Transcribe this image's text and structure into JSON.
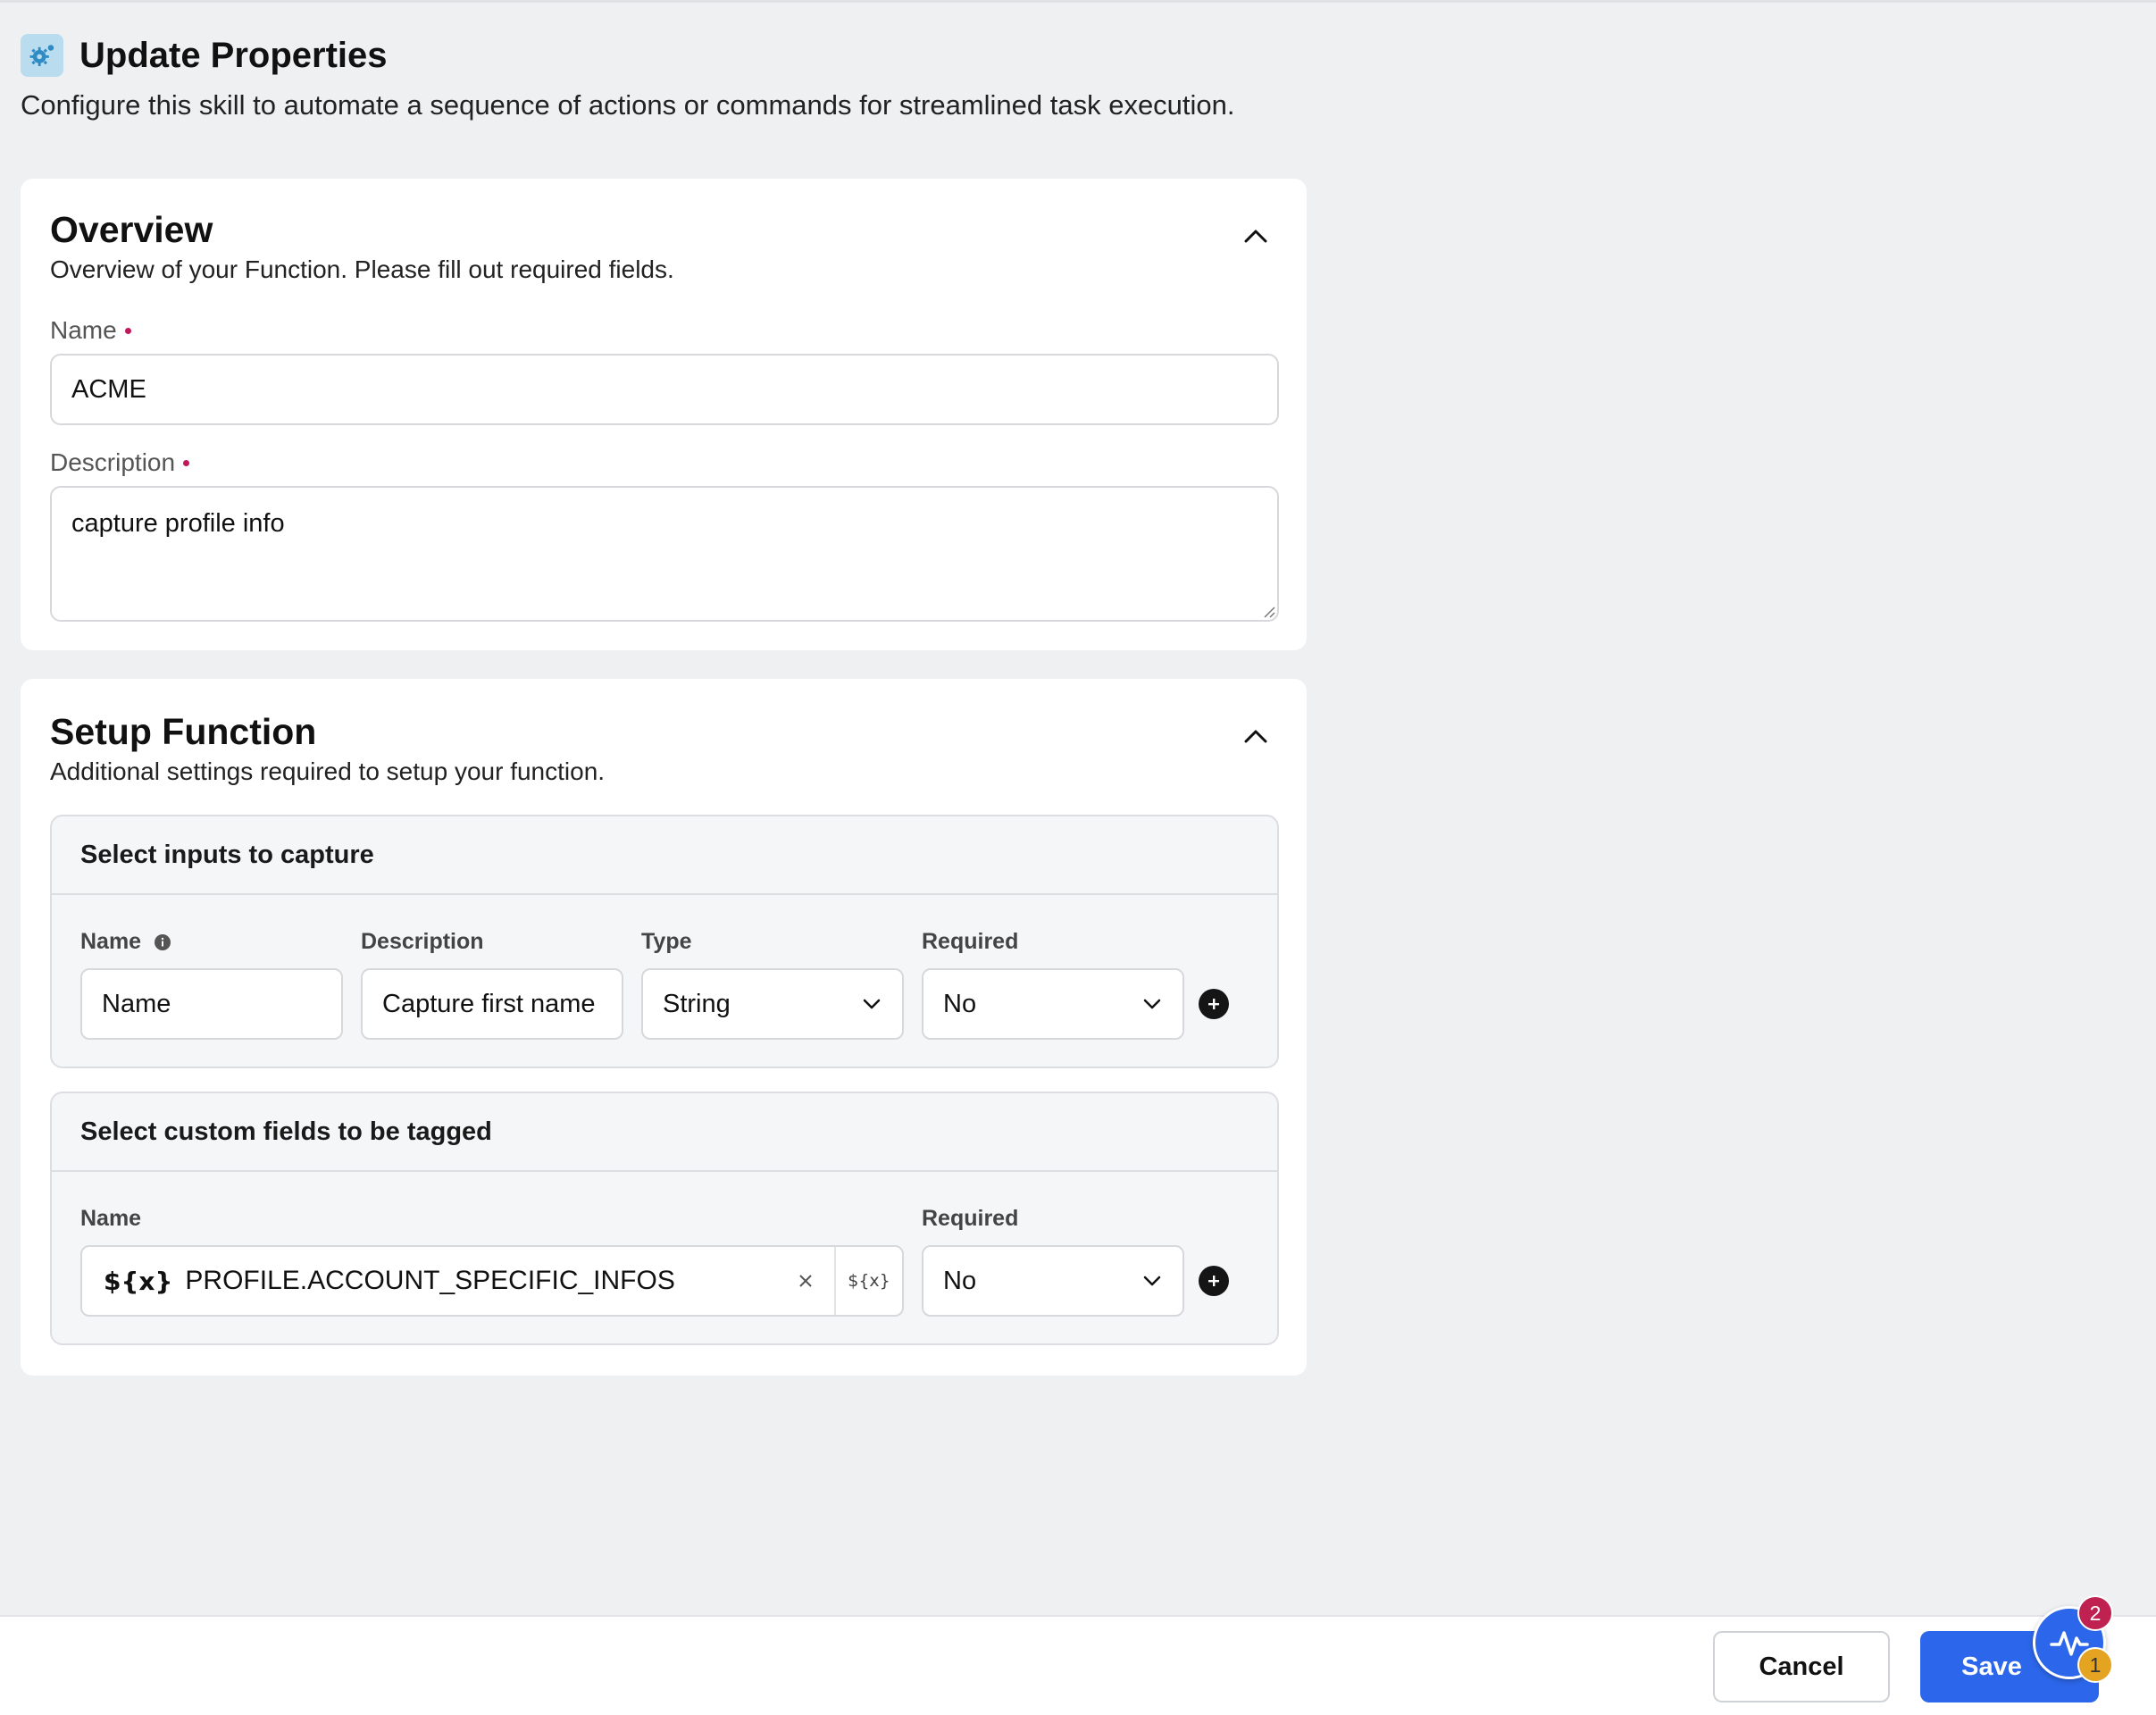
{
  "header": {
    "title": "Update Properties",
    "subtitle": "Configure this skill to automate a sequence of actions or commands for streamlined task execution.",
    "icon": "gear-icon"
  },
  "overview": {
    "title": "Overview",
    "description": "Overview of your Function. Please fill out required fields.",
    "name_label": "Name",
    "name_value": "ACME",
    "description_label": "Description",
    "description_value": "capture profile info"
  },
  "setup": {
    "title": "Setup Function",
    "description": "Additional settings required to setup your function.",
    "inputs_panel": {
      "title": "Select inputs to capture",
      "columns": [
        "Name",
        "Description",
        "Type",
        "Required"
      ],
      "row": {
        "name": "Name",
        "description": "Capture first name",
        "type": "String",
        "required": "No"
      }
    },
    "custom_panel": {
      "title": "Select custom fields to be tagged",
      "columns": [
        "Name",
        "Required"
      ],
      "row": {
        "var_badge": "${x}",
        "name": "PROFILE.ACCOUNT_SPECIFIC_INFOS",
        "insert_label": "${x}",
        "required": "No"
      }
    }
  },
  "footer": {
    "cancel_label": "Cancel",
    "save_label": "Save",
    "badge_count_red": "2",
    "badge_count_yellow": "1"
  },
  "colors": {
    "accent": "#2c66ea",
    "required_dot": "#c2185b",
    "badge_red": "#bf2150",
    "badge_yellow": "#e4a422"
  }
}
